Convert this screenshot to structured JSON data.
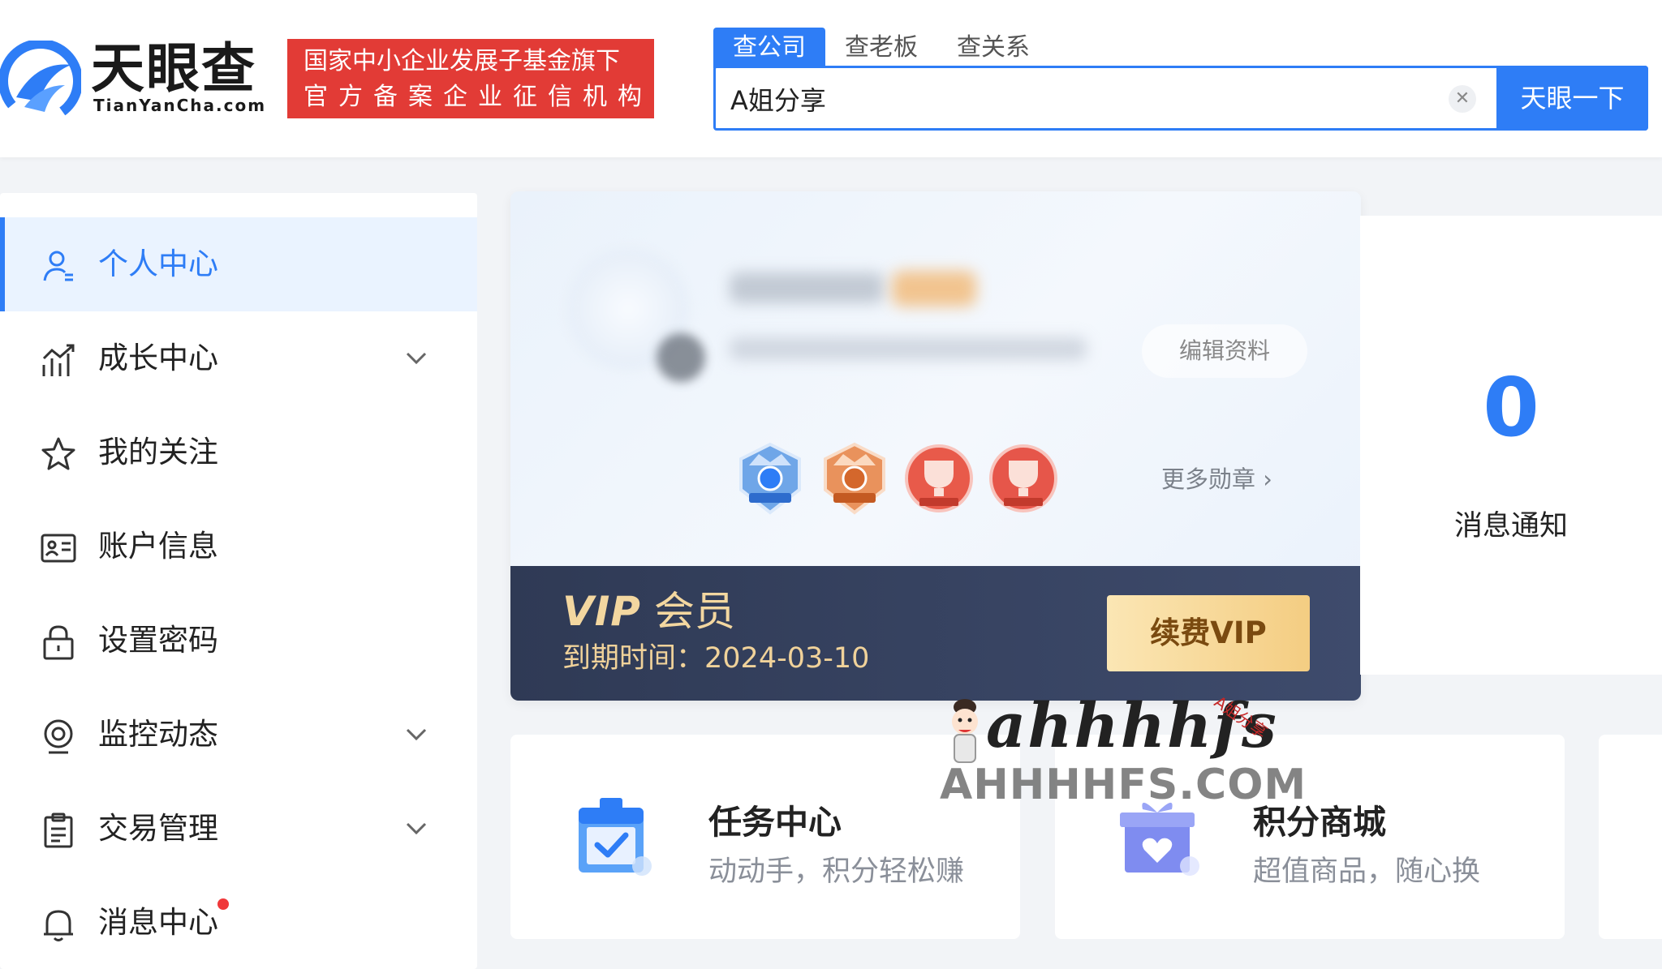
{
  "header": {
    "logo": {
      "cn": "天眼查",
      "en": "TianYanCha.com"
    },
    "badge": {
      "line1": "国家中小企业发展子基金旗下",
      "line2": "官方备案企业征信机构"
    },
    "search_tabs": [
      "查公司",
      "查老板",
      "查关系"
    ],
    "search_value": "A姐分享",
    "search_button": "天眼一下"
  },
  "sidebar": {
    "items": [
      {
        "label": "个人中心",
        "icon": "user-icon",
        "active": true
      },
      {
        "label": "成长中心",
        "icon": "growth-chart-icon",
        "expandable": true
      },
      {
        "label": "我的关注",
        "icon": "star-icon"
      },
      {
        "label": "账户信息",
        "icon": "id-card-icon"
      },
      {
        "label": "设置密码",
        "icon": "lock-icon"
      },
      {
        "label": "监控动态",
        "icon": "camera-icon",
        "expandable": true
      },
      {
        "label": "交易管理",
        "icon": "clipboard-icon",
        "expandable": true
      },
      {
        "label": "消息中心",
        "icon": "bell-icon",
        "has_notification": true
      }
    ]
  },
  "profile": {
    "edit_button": "编辑资料",
    "more_medals": "更多勋章",
    "medals": [
      "vip-medal-icon",
      "vip-pro-medal-icon",
      "lv1-trophy-icon",
      "lv2-trophy-icon"
    ]
  },
  "vip": {
    "title_en": "VIP",
    "title_cn": "会员",
    "expire_label": "到期时间：",
    "expire_date": "2024-03-10",
    "renew_button": "续费VIP"
  },
  "messages": {
    "count": "0",
    "label": "消息通知"
  },
  "cards": [
    {
      "title": "任务中心",
      "subtitle": "动动手，积分轻松赚",
      "icon": "task-calendar-icon"
    },
    {
      "title": "积分商城",
      "subtitle": "超值商品，随心换",
      "icon": "gift-box-icon"
    }
  ],
  "watermark": {
    "script": "ahhhhfs",
    "caps": "AHHHHFS.COM",
    "small": "A姐分享"
  },
  "colors": {
    "primary": "#2e7df6",
    "badge_red": "#e23b36",
    "vip_bg": "#36425f",
    "vip_gold": "#f3d7a0"
  }
}
